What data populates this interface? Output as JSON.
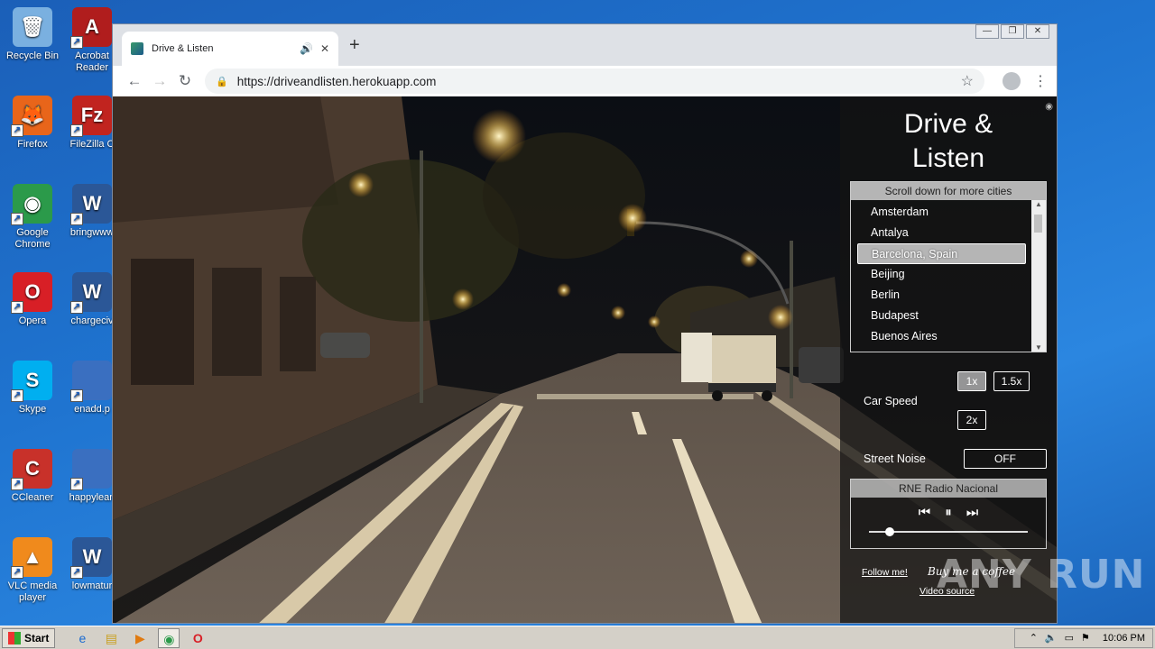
{
  "desktop": {
    "icons_col1": [
      {
        "label": "Recycle Bin",
        "icon": "recycle-bin-icon",
        "color": "#7ab0e0",
        "glyph": "🗑"
      },
      {
        "label": "Firefox",
        "icon": "firefox-icon",
        "color": "#e8651a",
        "glyph": "🦊"
      },
      {
        "label": "Google Chrome",
        "icon": "chrome-icon",
        "color": "#2b9a4a",
        "glyph": "◉"
      },
      {
        "label": "Opera",
        "icon": "opera-icon",
        "color": "#d81f26",
        "glyph": "O"
      },
      {
        "label": "Skype",
        "icon": "skype-icon",
        "color": "#00aff0",
        "glyph": "S"
      },
      {
        "label": "CCleaner",
        "icon": "ccleaner-icon",
        "color": "#c8312a",
        "glyph": "C"
      },
      {
        "label": "VLC media player",
        "icon": "vlc-icon",
        "color": "#f08a1c",
        "glyph": "▲"
      }
    ],
    "icons_col2": [
      {
        "label": "Acrobat Reader",
        "icon": "acrobat-icon",
        "color": "#b01d1d",
        "glyph": "A"
      },
      {
        "label": "FileZilla C",
        "icon": "filezilla-icon",
        "color": "#c1241f",
        "glyph": "Fz"
      },
      {
        "label": "bringwww",
        "icon": "word-doc-icon",
        "color": "#2b5797",
        "glyph": "W"
      },
      {
        "label": "chargeciv",
        "icon": "word-doc-icon",
        "color": "#2b5797",
        "glyph": "W"
      },
      {
        "label": "enadd.p",
        "icon": "file-icon",
        "color": "#3a6fc0",
        "glyph": ""
      },
      {
        "label": "happylean",
        "icon": "file-icon",
        "color": "#3a6fc0",
        "glyph": ""
      },
      {
        "label": "lowmatur",
        "icon": "word-doc-icon",
        "color": "#2b5797",
        "glyph": "W"
      }
    ]
  },
  "browser": {
    "tab_title": "Drive & Listen",
    "url": "https://driveandlisten.herokuapp.com",
    "new_tab": "+",
    "close_tab": "✕",
    "audio_icon": "🔊"
  },
  "app": {
    "title": "Drive & Listen",
    "city_header": "Scroll down for more cities",
    "cities": [
      "Amsterdam",
      "Antalya",
      "Barcelona, Spain",
      "Beijing",
      "Berlin",
      "Budapest",
      "Buenos Aires"
    ],
    "selected_city": "Barcelona, Spain",
    "car_speed_label": "Car Speed",
    "speed_1x": "1x",
    "speed_15x": "1.5x",
    "speed_2x": "2x",
    "selected_speed": "1x",
    "street_noise_label": "Street Noise",
    "street_noise_value": "OFF",
    "radio_station": "RNE Radio Nacional",
    "volume": 0.13,
    "follow_link": "Follow me!",
    "coffee_text": "Buy me a coffee",
    "video_source": "Video source"
  },
  "watermark": "ANY RUN",
  "taskbar": {
    "start_label": "Start",
    "clock": "10:06 PM"
  }
}
